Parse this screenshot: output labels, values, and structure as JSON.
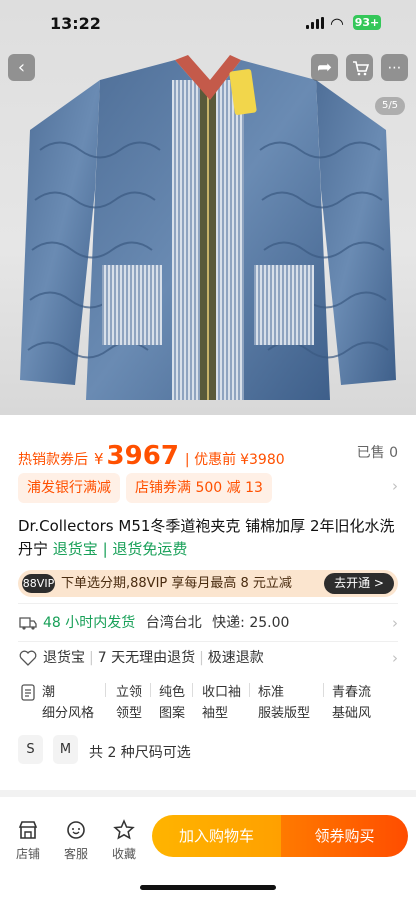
{
  "status": {
    "time": "13:22",
    "battery": "93+"
  },
  "gallery": {
    "counter": "5/5"
  },
  "price": {
    "label": "热销款券后",
    "currency": "¥",
    "value": "3967",
    "sep_label": "| 优惠前",
    "original": "¥3980",
    "sold": "已售 0"
  },
  "coupons": [
    "浦发银行满减",
    "店铺券满 500 减 13"
  ],
  "title": {
    "text": "Dr.Collectors M51冬季道袍夹克 铺棉加厚 2年旧化水洗丹宁",
    "tag": "退货宝 | 退货免运费"
  },
  "vip": {
    "badge": "88VIP",
    "text": "下单选分期,88VIP 享每月最高 8 元立减",
    "button": "去开通 >"
  },
  "shipping": {
    "time": "48 小时内发货",
    "origin": "台湾台北",
    "fee": "快递: 25.00"
  },
  "service": {
    "items": [
      "退货宝",
      "7 天无理由退货",
      "极速退款"
    ]
  },
  "attributes": [
    [
      "潮",
      "立领",
      "纯色",
      "收口袖",
      "标准",
      "青春流"
    ],
    [
      "细分风格",
      "领型",
      "图案",
      "袖型",
      "服装版型",
      "基础风"
    ]
  ],
  "sizes": {
    "options": [
      "S",
      "M"
    ],
    "summary": "共 2 种尺码可选"
  },
  "bottom": {
    "tools": [
      "店铺",
      "客服",
      "收藏"
    ],
    "add_cart": "加入购物车",
    "buy": "领券购买"
  }
}
